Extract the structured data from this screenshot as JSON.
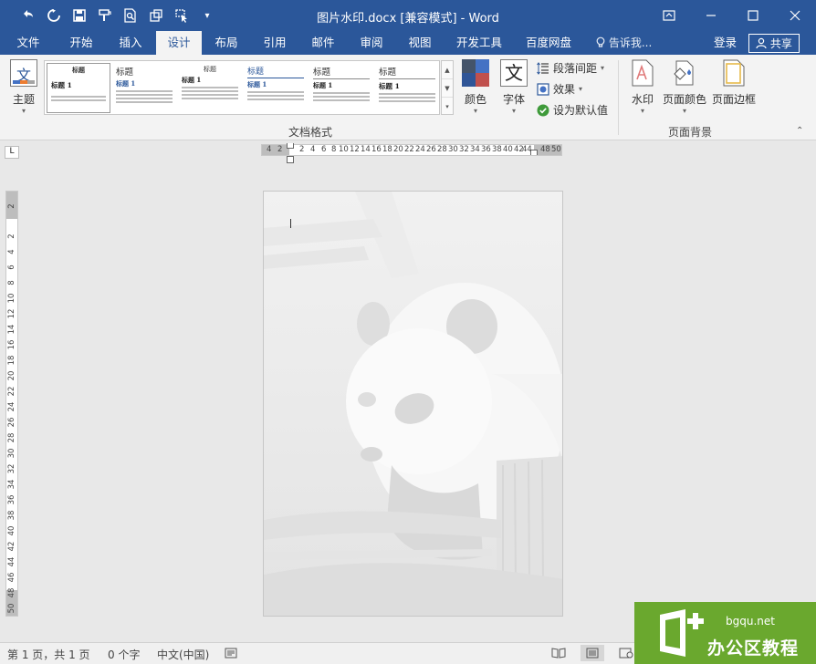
{
  "window": {
    "title": "图片水印.docx [兼容模式] - Word",
    "qat_icons": [
      "undo-icon",
      "redo-icon",
      "save-icon",
      "format-painter-icon",
      "print-preview-icon",
      "insert-icon",
      "select-icon",
      "customize-qat-icon"
    ],
    "controls": [
      "restore-ribbon-icon",
      "minimize-icon",
      "maximize-icon",
      "close-icon"
    ]
  },
  "tabs": {
    "file": "文件",
    "home": "开始",
    "insert": "插入",
    "design": "设计",
    "layout": "布局",
    "references": "引用",
    "mailings": "邮件",
    "review": "审阅",
    "view": "视图",
    "developer": "开发工具",
    "baidu": "百度网盘",
    "tell_me": "告诉我...",
    "login": "登录",
    "share": "共享"
  },
  "ribbon": {
    "theme_label": "主题",
    "theme_icon_glyph": "文",
    "gallery": [
      {
        "heading": "标题",
        "sub": "标题 1"
      },
      {
        "heading": "标题",
        "sub": "标题 1"
      },
      {
        "heading": "标题",
        "sub": "标题 1"
      },
      {
        "heading": "标题",
        "sub": "标题 1"
      },
      {
        "heading": "标题",
        "sub": "标题 1"
      },
      {
        "heading": "标题",
        "sub": "标题 1"
      }
    ],
    "colors_label": "颜色",
    "fonts_label": "字体",
    "fonts_icon_glyph": "文",
    "paragraph_spacing_label": "段落间距",
    "effects_label": "效果",
    "set_default_label": "设为默认值",
    "doc_format_group": "文档格式",
    "watermark_label": "水印",
    "page_color_label": "页面颜色",
    "page_border_label": "页面边框",
    "page_background_group": "页面背景"
  },
  "ruler": {
    "horizontal_left": [
      "4",
      "2"
    ],
    "horizontal": [
      "2",
      "4",
      "6",
      "8",
      "10",
      "12",
      "14",
      "16",
      "18",
      "20",
      "22",
      "24",
      "26",
      "28",
      "30",
      "32",
      "34",
      "36",
      "38",
      "40",
      "42",
      "44"
    ],
    "horizontal_right": [
      "48",
      "50"
    ],
    "vertical_top": [
      "2"
    ],
    "vertical": [
      "2",
      "4",
      "6",
      "8",
      "10",
      "12",
      "14",
      "16",
      "18",
      "20",
      "22",
      "24",
      "26",
      "28",
      "30",
      "32",
      "34",
      "36",
      "38",
      "40",
      "42",
      "44",
      "46",
      "48",
      "50"
    ],
    "corner_glyph": "L"
  },
  "status": {
    "page": "第 1 页，共 1 页",
    "words": "0 个字",
    "language": "中文(中国)"
  },
  "brand": {
    "url": "bgqu.net",
    "name": "办公区教程"
  },
  "colors": {
    "accent": "#2b579a",
    "brand_green": "#6aa82e"
  }
}
